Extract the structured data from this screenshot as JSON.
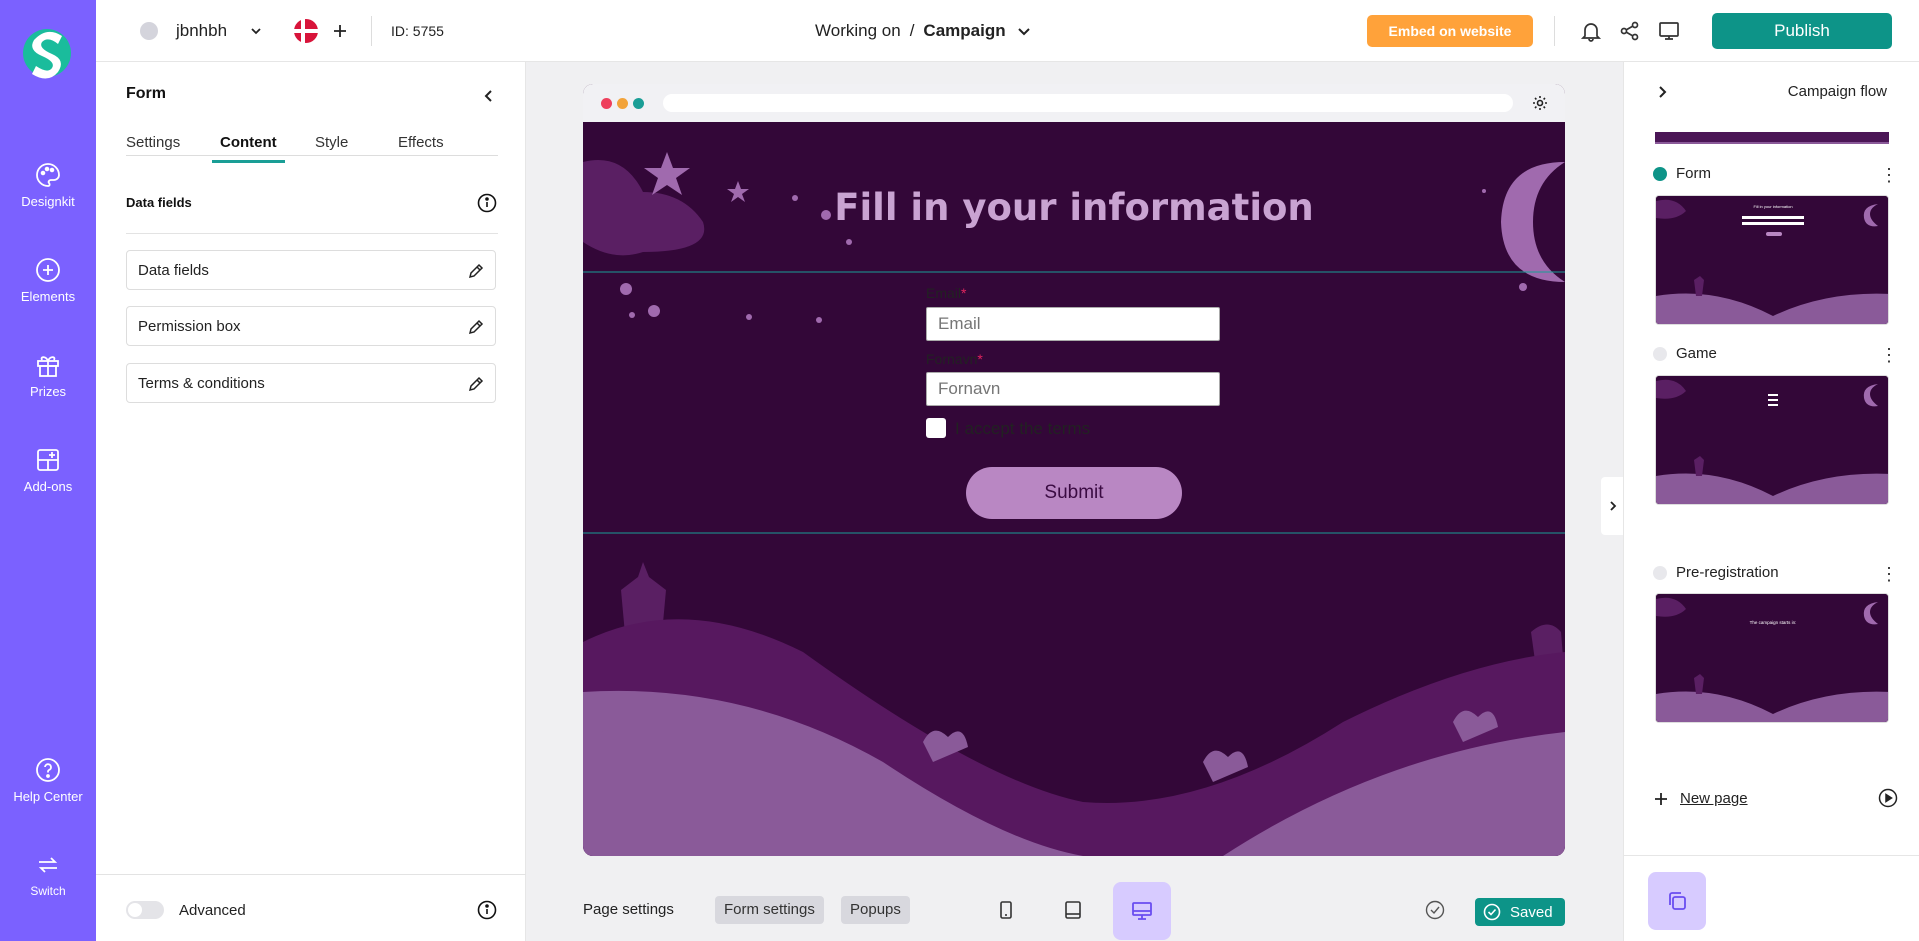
{
  "sidebar": {
    "items": [
      {
        "label": "Designkit",
        "icon": "palette-icon"
      },
      {
        "label": "Elements",
        "icon": "plus-circle-icon"
      },
      {
        "label": "Prizes",
        "icon": "gift-icon"
      },
      {
        "label": "Add-ons",
        "icon": "add-ons-icon"
      },
      {
        "label": "Help Center",
        "icon": "help-icon"
      },
      {
        "label": "Switch",
        "icon": "switch-icon"
      }
    ]
  },
  "header": {
    "account": "jbnhbh",
    "id_label": "ID: 5755",
    "working_on": "Working on",
    "separator": "/",
    "campaign": "Campaign",
    "embed_label": "Embed on website",
    "publish_label": "Publish"
  },
  "left_panel": {
    "title": "Form",
    "tabs": [
      "Settings",
      "Content",
      "Style",
      "Effects"
    ],
    "active_tab": "Content",
    "section_title": "Data fields",
    "fields": [
      "Data fields",
      "Permission box",
      "Terms & conditions"
    ],
    "advanced_label": "Advanced"
  },
  "preview": {
    "heading": "Fill in your information",
    "email_label": "Email",
    "email_placeholder": "Email",
    "name_label": "Fornavn",
    "name_placeholder": "Fornavn",
    "terms_label": "I accept the terms",
    "submit_label": "Submit"
  },
  "bottom_bar": {
    "page_settings": "Page settings",
    "form_settings": "Form settings",
    "popups": "Popups",
    "saved_label": "Saved"
  },
  "right_panel": {
    "title": "Campaign flow",
    "pages": [
      {
        "label": "Form",
        "active": true
      },
      {
        "label": "Game",
        "active": false
      },
      {
        "label": "Pre-registration",
        "active": false
      }
    ],
    "new_page": "New page",
    "thumb_form_text": "Fill in your information",
    "thumb_prereg_text": "The campaign starts in:"
  },
  "colors": {
    "nav_purple": "#7b61ff",
    "teal": "#0d9488",
    "orange": "#ffa23a",
    "scene_bg": "#330738",
    "accent_tab": "#1a9e96"
  }
}
